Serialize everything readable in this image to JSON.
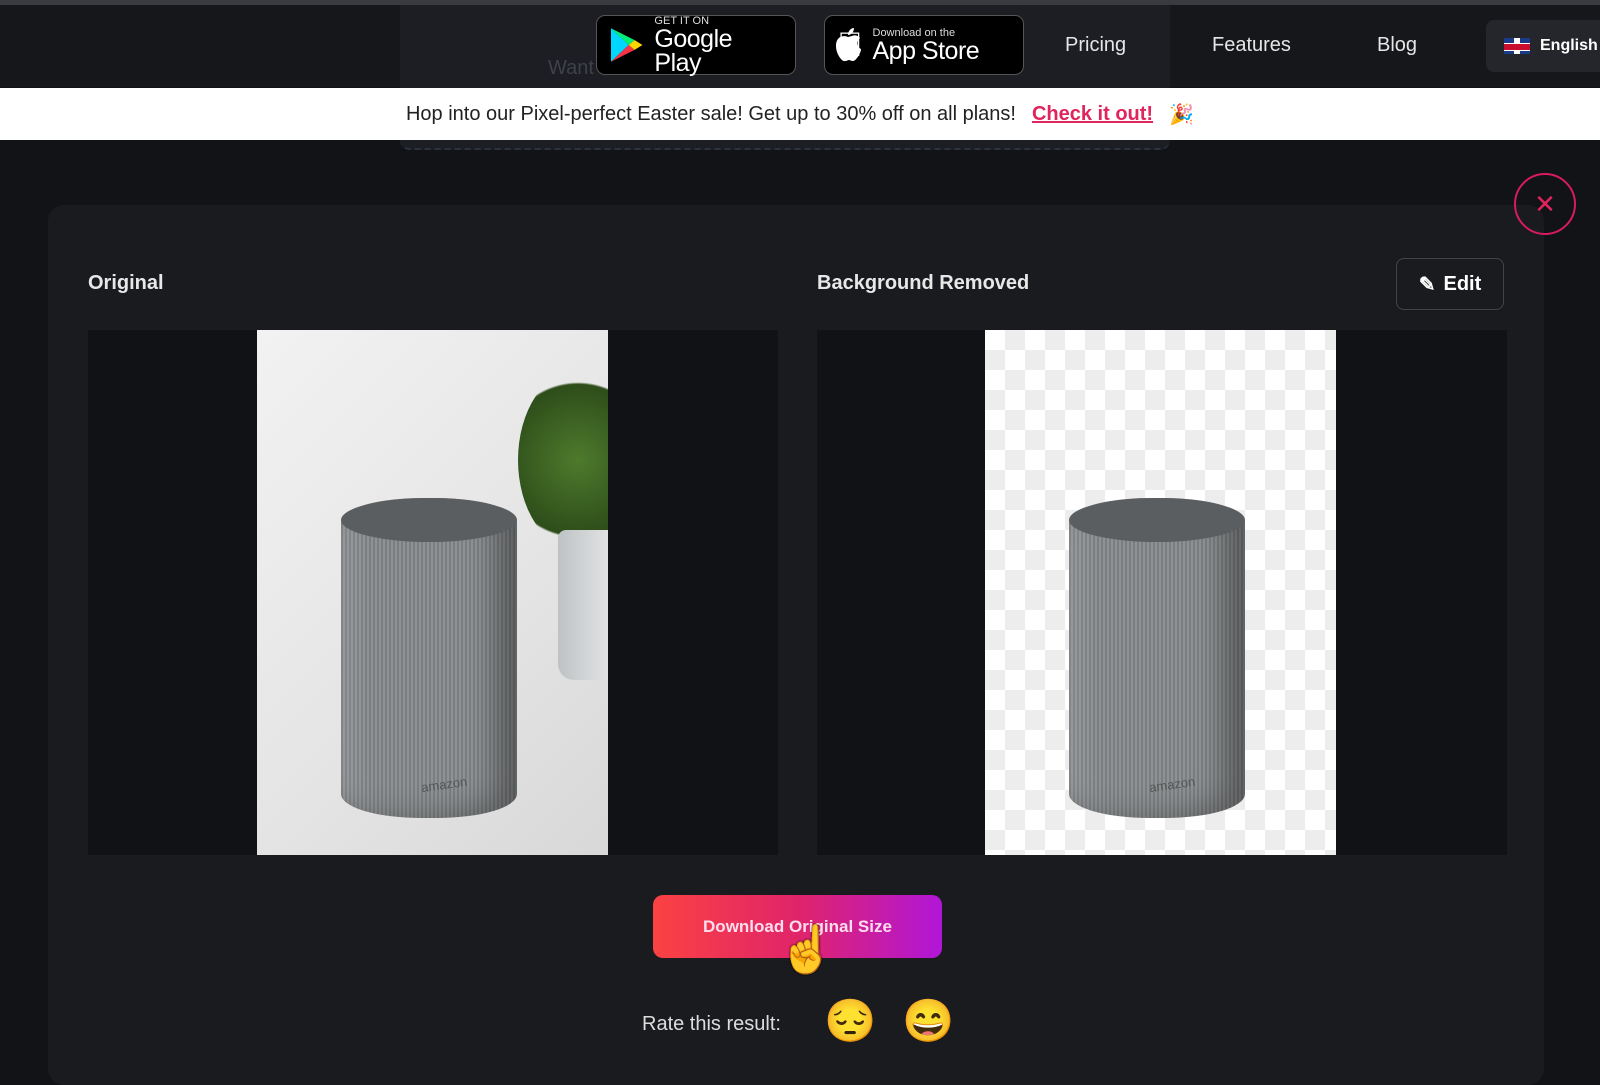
{
  "nav": {
    "ghost_text": "Want … un… k?",
    "google_play": {
      "small": "GET IT ON",
      "big": "Google Play"
    },
    "app_store": {
      "small": "Download on the",
      "big": "App Store"
    },
    "links": [
      "Pricing",
      "Features",
      "Blog"
    ],
    "language": "English"
  },
  "promo": {
    "text": "Hop into our Pixel-perfect Easter sale! Get up to 30% off on all plans!",
    "link": "Check it out!",
    "emoji": "🎉"
  },
  "result": {
    "original_label": "Original",
    "removed_label": "Background Removed",
    "edit_label": "Edit",
    "download_label": "Download Original Size",
    "rate_label": "Rate this result:",
    "rate_options": [
      "😔",
      "😄"
    ],
    "brand_on_product": "amazon"
  },
  "colors": {
    "accent": "#e0245e",
    "gradient_start": "#fb4242",
    "gradient_end": "#b116d8"
  }
}
